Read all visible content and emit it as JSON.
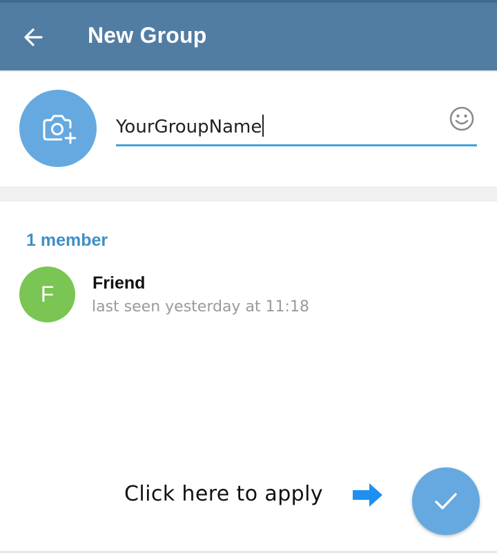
{
  "header": {
    "title": "New Group",
    "back_icon": "arrow-left-icon"
  },
  "group": {
    "photo_icon": "camera-add-icon",
    "name_value": "YourGroupName",
    "emoji_icon": "smiley-icon"
  },
  "members": {
    "header": "1 member",
    "items": [
      {
        "initial": "F",
        "name": "Friend",
        "status": "last seen yesterday at 11:18",
        "avatar_color": "#7ac553"
      }
    ]
  },
  "hint": {
    "text": "Click here to apply",
    "arrow_icon": "arrow-right-icon"
  },
  "fab": {
    "icon": "check-icon"
  },
  "colors": {
    "header_bg": "#527da3",
    "accent": "#65a9e0",
    "members_header": "#3d8fc8",
    "input_underline": "#3fa3d8",
    "hint_arrow": "#1e8ff0"
  }
}
